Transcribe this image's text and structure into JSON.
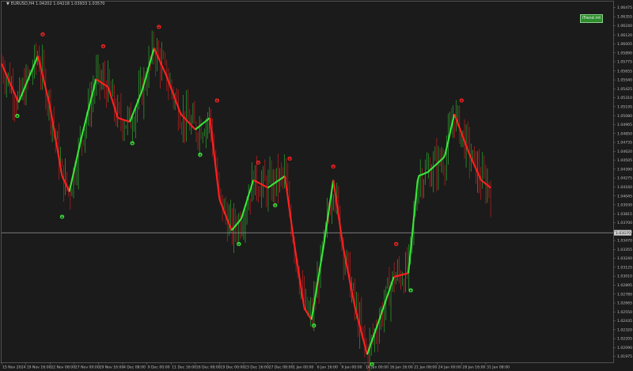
{
  "window": {
    "symbol_info": "EURUSD,H4  1.04202 1.04218 1.03933 1.03570"
  },
  "indicator": {
    "badge_label": "iTrend mt",
    "up_color": "#39e639",
    "down_color": "#ff2020",
    "signal_glyph": "Θ"
  },
  "current_price": {
    "label": "1.03570",
    "line_color": "#9a9a9a"
  },
  "price_scale": {
    "labels": [
      "1.06475",
      "1.06355",
      "1.06240",
      "1.06120",
      "1.06005",
      "1.05890",
      "1.05775",
      "1.05655",
      "1.05540",
      "1.05425",
      "1.05310",
      "1.05195",
      "1.05080",
      "1.04965",
      "1.04850",
      "1.04735",
      "1.04620",
      "1.04505",
      "1.04390",
      "1.04275",
      "1.04160",
      "1.04045",
      "1.03930",
      "1.03815",
      "1.03700",
      "1.03585",
      "1.03470",
      "1.03355",
      "1.03240",
      "1.03125",
      "1.03010",
      "1.02895",
      "1.02780",
      "1.02665",
      "1.02550",
      "1.02435",
      "1.02320",
      "1.02205",
      "1.02090",
      "1.01975"
    ]
  },
  "time_scale": {
    "labels": [
      "15 Nov 2024",
      "19 Nov 16:00",
      "22 Nov 08:00",
      "27 Nov 00:00",
      "29 Nov 16:00",
      "4 Dec 08:00",
      "9 Dec 00:00",
      "11 Dec 16:00",
      "16 Dec 08:00",
      "19 Dec 00:00",
      "23 Dec 16:00",
      "27 Dec 08:00",
      "1 Jan 00:00",
      "6 Jan 16:00",
      "9 Jan 00:00",
      "14 Jan 00:00",
      "16 Jan 16:00",
      "21 Jan 08:00",
      "24 Jan 00:00",
      "28 Jan 16:00",
      "31 Jan 08:00"
    ]
  },
  "chart_data": {
    "type": "candlestick",
    "instrument": "EURUSD",
    "timeframe": "H4",
    "ylim": [
      1.019,
      1.0655
    ],
    "x": [
      "15 Nov 2024",
      "19 Nov 16:00",
      "22 Nov 08:00",
      "27 Nov 00:00",
      "29 Nov 16:00",
      "4 Dec 08:00",
      "9 Dec 00:00",
      "11 Dec 16:00",
      "16 Dec 08:00",
      "19 Dec 00:00",
      "23 Dec 16:00",
      "27 Dec 08:00",
      "1 Jan 00:00",
      "6 Jan 16:00",
      "9 Jan 00:00",
      "14 Jan 00:00",
      "16 Jan 16:00",
      "21 Jan 08:00",
      "24 Jan 00:00",
      "28 Jan 16:00",
      "31 Jan 08:00"
    ],
    "trend_line": {
      "points": [
        [
          0,
          1.0575
        ],
        [
          0.7,
          1.0525
        ],
        [
          1.5,
          1.0585
        ],
        [
          2.0,
          1.052
        ],
        [
          2.5,
          1.043
        ],
        [
          2.8,
          1.041
        ],
        [
          3.3,
          1.048
        ],
        [
          3.9,
          1.0555
        ],
        [
          4.4,
          1.0545
        ],
        [
          4.8,
          1.0505
        ],
        [
          5.3,
          1.05
        ],
        [
          5.8,
          1.054
        ],
        [
          6.3,
          1.0595
        ],
        [
          6.8,
          1.056
        ],
        [
          7.4,
          1.051
        ],
        [
          8.0,
          1.049
        ],
        [
          8.6,
          1.0505
        ],
        [
          9.0,
          1.04
        ],
        [
          9.5,
          1.036
        ],
        [
          9.9,
          1.0375
        ],
        [
          10.4,
          1.0425
        ],
        [
          11.0,
          1.0415
        ],
        [
          11.7,
          1.043
        ],
        [
          12.1,
          1.034
        ],
        [
          12.5,
          1.026
        ],
        [
          12.8,
          1.0245
        ],
        [
          13.3,
          1.034
        ],
        [
          13.7,
          1.0425
        ],
        [
          14.1,
          1.034
        ],
        [
          14.6,
          1.026
        ],
        [
          15.1,
          1.02
        ],
        [
          15.6,
          1.0245
        ],
        [
          16.2,
          1.03
        ],
        [
          16.8,
          1.0305
        ],
        [
          17.2,
          1.043
        ],
        [
          17.6,
          1.0435
        ],
        [
          18.3,
          1.0455
        ],
        [
          18.7,
          1.051
        ],
        [
          19.3,
          1.046
        ],
        [
          19.8,
          1.0425
        ],
        [
          20.2,
          1.0415
        ]
      ],
      "segments": [
        {
          "from": 0,
          "to": 0.7,
          "trend": "down"
        },
        {
          "from": 0.7,
          "to": 1.5,
          "trend": "up"
        },
        {
          "from": 1.5,
          "to": 2.8,
          "trend": "down"
        },
        {
          "from": 2.8,
          "to": 3.9,
          "trend": "up"
        },
        {
          "from": 3.9,
          "to": 5.3,
          "trend": "down"
        },
        {
          "from": 5.3,
          "to": 6.3,
          "trend": "up"
        },
        {
          "from": 6.3,
          "to": 8.0,
          "trend": "down"
        },
        {
          "from": 8.0,
          "to": 8.6,
          "trend": "up"
        },
        {
          "from": 8.6,
          "to": 9.5,
          "trend": "down"
        },
        {
          "from": 9.5,
          "to": 10.4,
          "trend": "up"
        },
        {
          "from": 10.4,
          "to": 11.0,
          "trend": "down"
        },
        {
          "from": 11.0,
          "to": 11.7,
          "trend": "up"
        },
        {
          "from": 11.7,
          "to": 12.8,
          "trend": "down"
        },
        {
          "from": 12.8,
          "to": 13.7,
          "trend": "up"
        },
        {
          "from": 13.7,
          "to": 15.1,
          "trend": "down"
        },
        {
          "from": 15.1,
          "to": 16.2,
          "trend": "up"
        },
        {
          "from": 16.2,
          "to": 16.8,
          "trend": "down"
        },
        {
          "from": 16.8,
          "to": 18.7,
          "trend": "up"
        },
        {
          "from": 18.7,
          "to": 20.2,
          "trend": "down"
        }
      ]
    },
    "signals": [
      {
        "x": 0.65,
        "price": 1.0505,
        "type": "up"
      },
      {
        "x": 1.7,
        "price": 1.061,
        "type": "down"
      },
      {
        "x": 2.5,
        "price": 1.0375,
        "type": "up"
      },
      {
        "x": 4.2,
        "price": 1.0595,
        "type": "down"
      },
      {
        "x": 5.4,
        "price": 1.047,
        "type": "up"
      },
      {
        "x": 6.5,
        "price": 1.062,
        "type": "down"
      },
      {
        "x": 8.2,
        "price": 1.0455,
        "type": "up"
      },
      {
        "x": 8.9,
        "price": 1.0525,
        "type": "down"
      },
      {
        "x": 9.8,
        "price": 1.034,
        "type": "up"
      },
      {
        "x": 10.6,
        "price": 1.0445,
        "type": "down"
      },
      {
        "x": 11.3,
        "price": 1.039,
        "type": "up"
      },
      {
        "x": 11.9,
        "price": 1.045,
        "type": "down"
      },
      {
        "x": 12.9,
        "price": 1.0235,
        "type": "up"
      },
      {
        "x": 13.7,
        "price": 1.044,
        "type": "down"
      },
      {
        "x": 15.3,
        "price": 1.0185,
        "type": "up"
      },
      {
        "x": 16.3,
        "price": 1.034,
        "type": "down"
      },
      {
        "x": 16.9,
        "price": 1.028,
        "type": "up"
      },
      {
        "x": 19.0,
        "price": 1.0525,
        "type": "down"
      }
    ]
  }
}
